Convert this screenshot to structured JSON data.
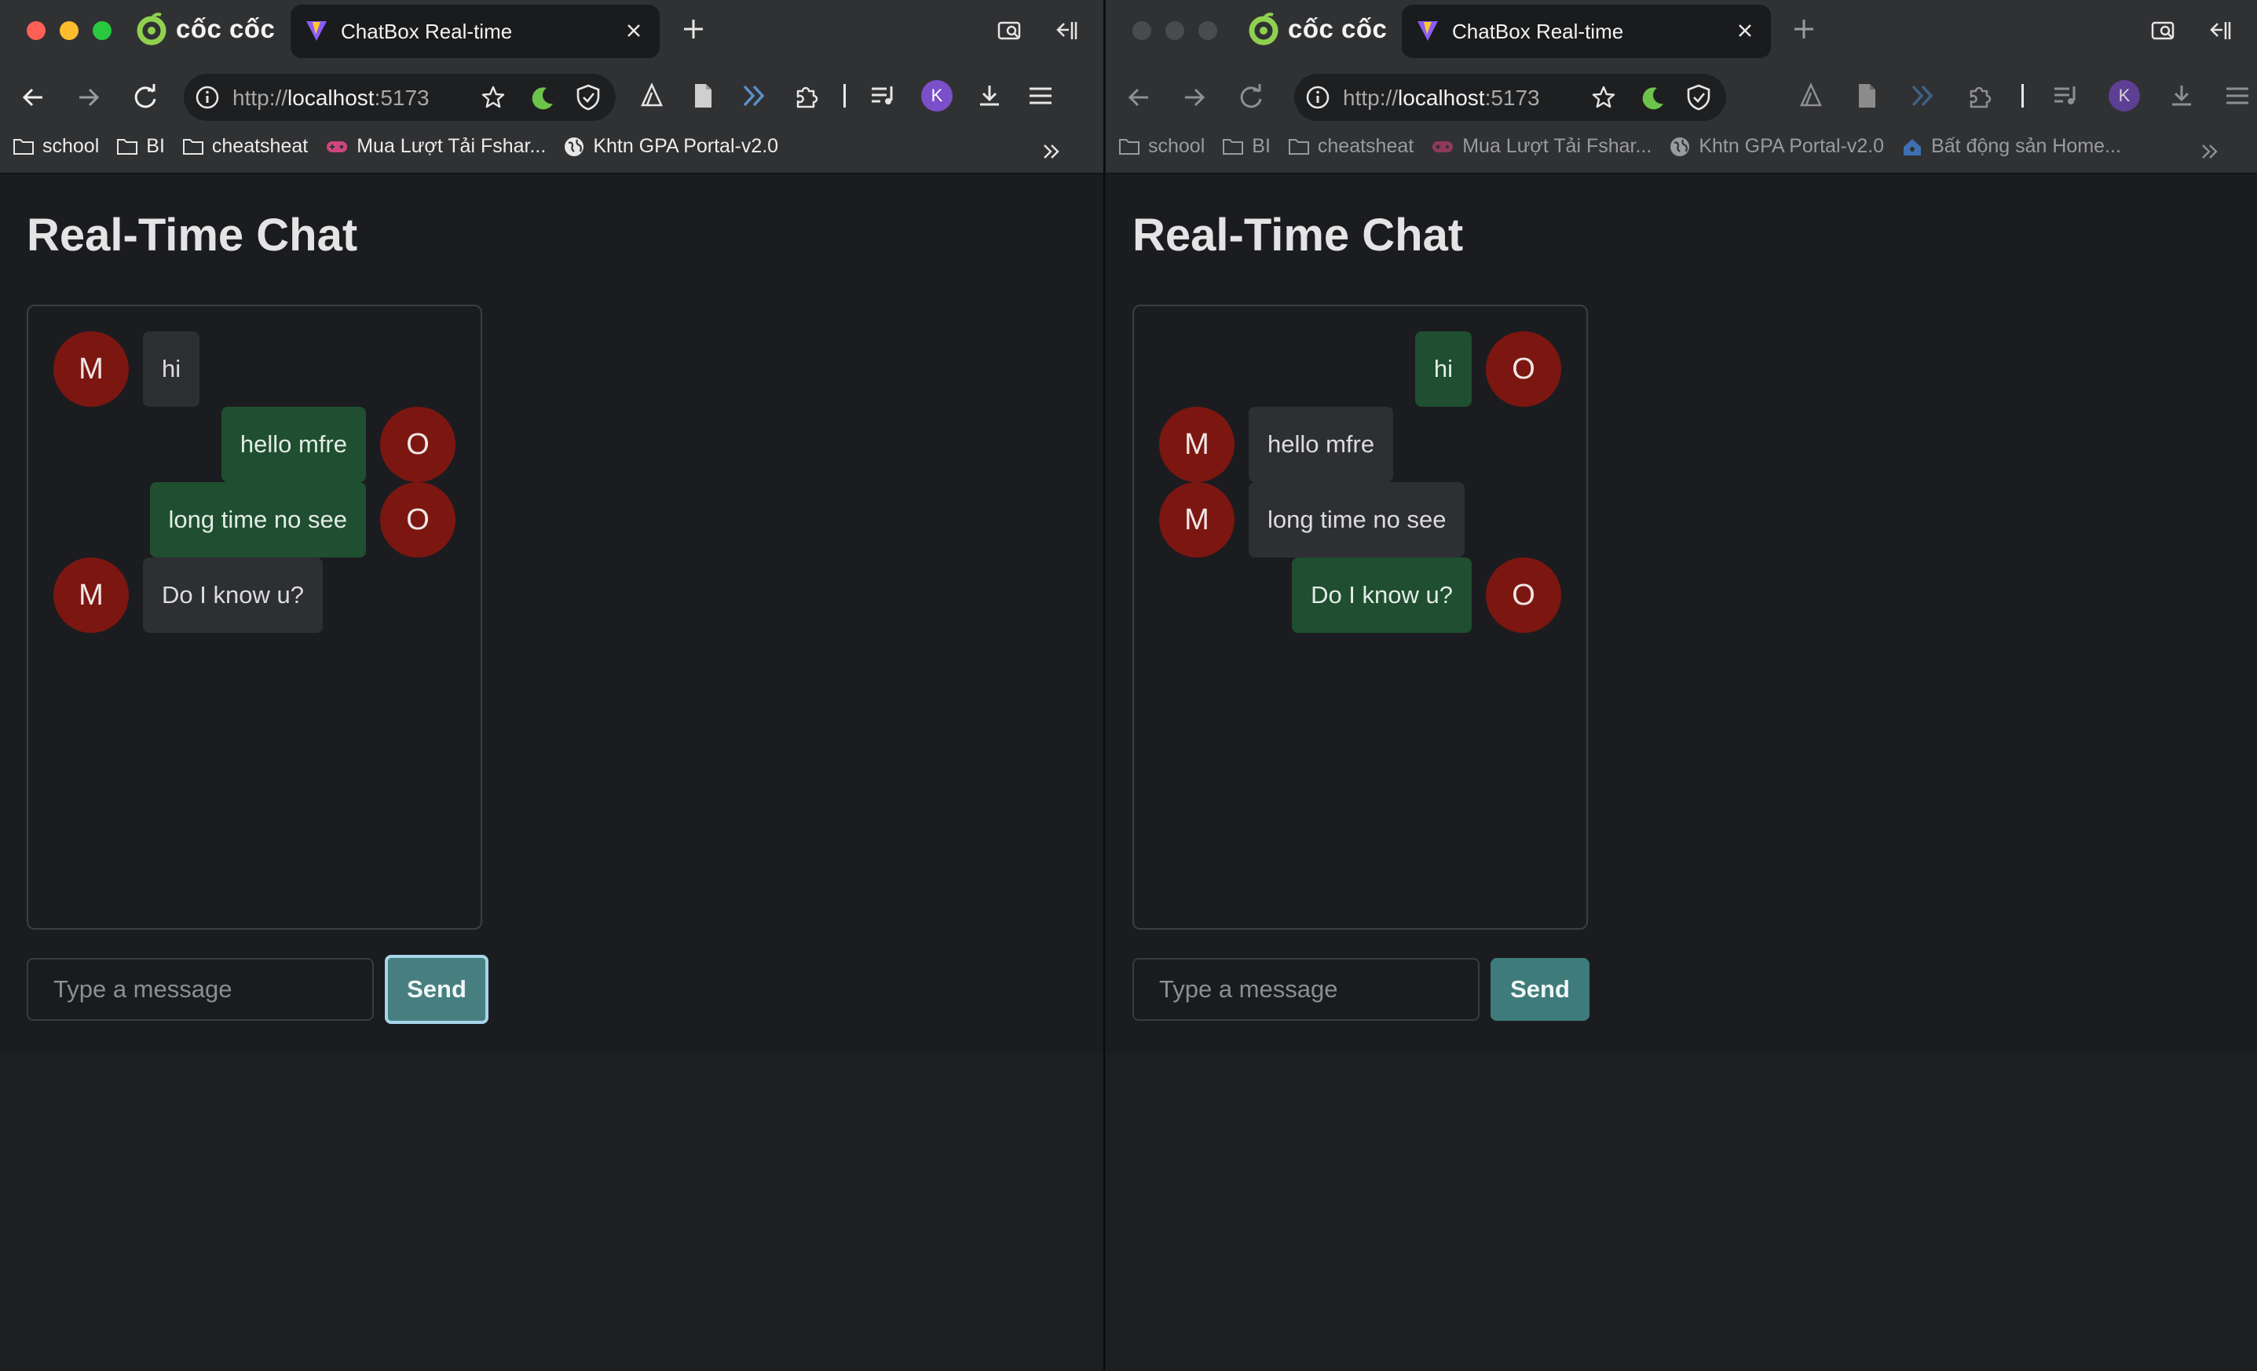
{
  "browser": {
    "brand": "cốc cốc",
    "tab_title": "ChatBox Real-time",
    "url_scheme": "http://",
    "url_host": "localhost",
    "url_port": ":5173",
    "profile_initial": "K"
  },
  "bookmarks_left": [
    "school",
    "BI",
    "cheatsheat",
    "Mua Lượt Tải Fshar...",
    "Khtn GPA Portal-v2.0"
  ],
  "bookmarks_right": [
    "school",
    "BI",
    "cheatsheat",
    "Mua Lượt Tải Fshar...",
    "Khtn GPA Portal-v2.0",
    "Bất động sản Home..."
  ],
  "app": {
    "title": "Real-Time Chat",
    "input_placeholder": "Type a message",
    "send_label": "Send"
  },
  "left_view": {
    "messages": [
      {
        "sender": "M",
        "text": "hi",
        "own": false
      },
      {
        "sender": "O",
        "text": "hello mfre",
        "own": true
      },
      {
        "sender": "O",
        "text": "long time no see",
        "own": true
      },
      {
        "sender": "M",
        "text": "Do I know u?",
        "own": false
      }
    ]
  },
  "right_view": {
    "messages": [
      {
        "sender": "O",
        "text": "hi",
        "own": true
      },
      {
        "sender": "M",
        "text": "hello mfre",
        "own": false
      },
      {
        "sender": "M",
        "text": "long time no see",
        "own": false
      },
      {
        "sender": "O",
        "text": "Do I know u?",
        "own": true
      }
    ]
  },
  "colors": {
    "own_bubble": "#1f4e30",
    "other_bubble": "#2d2f33",
    "avatar": "#7c1611",
    "send_button": "#3e7c7b"
  }
}
